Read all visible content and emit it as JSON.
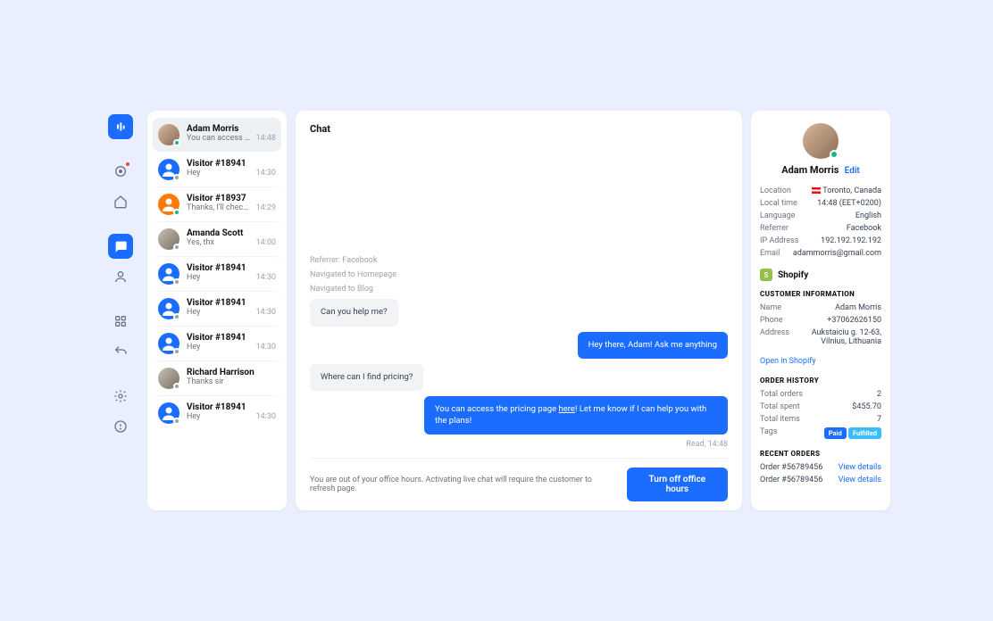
{
  "sidebar": {
    "nav": [
      "brand",
      "activity",
      "home",
      "chat",
      "user",
      "grid",
      "reply",
      "settings",
      "logout"
    ]
  },
  "conversations": [
    {
      "name": "Adam Morris",
      "preview": "You can access the pr...",
      "time": "14:48",
      "avatar": "photo",
      "status": "green",
      "selected": true
    },
    {
      "name": "Visitor #18941",
      "preview": "Hey",
      "time": "14:30",
      "avatar": "blue",
      "status": "gray"
    },
    {
      "name": "Visitor #18937",
      "preview": "Thanks, I'll check it out",
      "time": "14:29",
      "avatar": "orange",
      "status": "green"
    },
    {
      "name": "Amanda Scott",
      "preview": "Yes, thx",
      "time": "14:00",
      "avatar": "photo2",
      "status": "gray"
    },
    {
      "name": "Visitor #18941",
      "preview": "Hey",
      "time": "14:30",
      "avatar": "blue",
      "status": "gray"
    },
    {
      "name": "Visitor #18941",
      "preview": "Hey",
      "time": "14:30",
      "avatar": "blue",
      "status": "gray"
    },
    {
      "name": "Visitor #18941",
      "preview": "Hey",
      "time": "14:30",
      "avatar": "blue",
      "status": "gray"
    },
    {
      "name": "Richard Harrison",
      "preview": "Thanks sir",
      "time": "",
      "avatar": "photo2",
      "status": "gray"
    },
    {
      "name": "Visitor #18941",
      "preview": "Hey",
      "time": "14:30",
      "avatar": "blue",
      "status": "gray"
    }
  ],
  "chat": {
    "title": "Chat",
    "meta": [
      "Referrer: Facebook",
      "Navigated to Homepage",
      "Navigated to Blog"
    ],
    "messages": [
      {
        "dir": "in",
        "text": "Can you help me?"
      },
      {
        "dir": "out",
        "text": "Hey there, Adam! Ask me anything"
      },
      {
        "dir": "in",
        "text": "Where can I find pricing?"
      },
      {
        "dir": "out",
        "text_pre": "You can access the pricing page ",
        "link": "here",
        "text_post": "! Let me know if I can help you with the plans!"
      }
    ],
    "read": "Read, 14:48",
    "footer_text": "You are out of your office hours. Activating live chat will require the customer to refresh page.",
    "footer_button": "Turn off office hours"
  },
  "details": {
    "name": "Adam Morris",
    "edit": "Edit",
    "info": [
      {
        "k": "Location",
        "v": "Toronto, Canada",
        "flag": true
      },
      {
        "k": "Local time",
        "v": "14:48 (EET+0200)"
      },
      {
        "k": "Language",
        "v": "English"
      },
      {
        "k": "Referrer",
        "v": "Facebook"
      },
      {
        "k": "IP Address",
        "v": "192.192.192.192"
      },
      {
        "k": "Email",
        "v": "adammorris@gmail.com"
      }
    ],
    "shopify": "Shopify",
    "cust_heading": "CUSTOMER INFORMATION",
    "cust": [
      {
        "k": "Name",
        "v": "Adam Morris"
      },
      {
        "k": "Phone",
        "v": "+37062626150"
      },
      {
        "k": "Address",
        "v": "Aukstaiciu g. 12-63, Vilnius, Lithuania",
        "addr": true
      }
    ],
    "open_shopify": "Open in Shopify",
    "order_heading": "ORDER HISTORY",
    "orders": [
      {
        "k": "Total orders",
        "v": "2"
      },
      {
        "k": "Total spent",
        "v": "$455.70"
      },
      {
        "k": "Total items",
        "v": "7"
      }
    ],
    "tags_label": "Tags",
    "tags": [
      "Paid",
      "Fulfilled"
    ],
    "recent_heading": "RECENT ORDERS",
    "recent": [
      {
        "id": "Order #56789456",
        "action": "View details"
      },
      {
        "id": "Order #56789456",
        "action": "View details"
      }
    ]
  }
}
